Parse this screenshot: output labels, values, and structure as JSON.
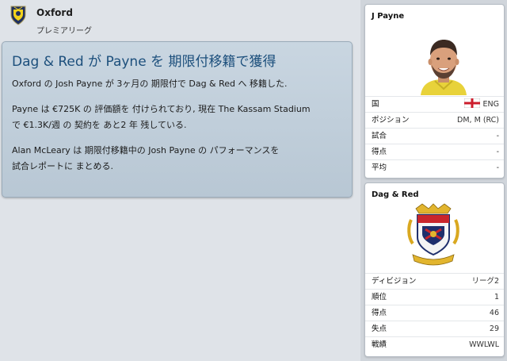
{
  "header": {
    "club_name": "Oxford",
    "league": "プレミアリーグ"
  },
  "news": {
    "title": "Dag & Red が Payne を 期限付移籍で獲得",
    "paragraphs": [
      "Oxford の Josh Payne が 3ヶ月の 期限付で Dag & Red へ 移籍した.",
      "Payne は €725K の 評価額を 付けられており, 現在 The Kassam Stadium\nで €1.3K/週 の 契約を あと2 年 残している.",
      "Alan McLeary は 期限付移籍中の Josh Payne の パフォーマンスを\n試合レポートに まとめる."
    ]
  },
  "player_card": {
    "name": "J Payne",
    "rows": [
      {
        "label": "国",
        "value": "ENG"
      },
      {
        "label": "ポジション",
        "value": "DM, M (RC)"
      },
      {
        "label": "試合",
        "value": "-"
      },
      {
        "label": "得点",
        "value": "-"
      },
      {
        "label": "平均",
        "value": "-"
      }
    ]
  },
  "club_card": {
    "name": "Dag & Red",
    "rows": [
      {
        "label": "ディビジョン",
        "value": "リーグ2"
      },
      {
        "label": "順位",
        "value": "1"
      },
      {
        "label": "得点",
        "value": "46"
      },
      {
        "label": "失点",
        "value": "29"
      },
      {
        "label": "戦績",
        "value": "WWLWL"
      }
    ]
  },
  "colors": {
    "news_title": "#1c4f7c",
    "panel_bg": "#c2d0dc",
    "side_bg": "#d0d5db"
  }
}
